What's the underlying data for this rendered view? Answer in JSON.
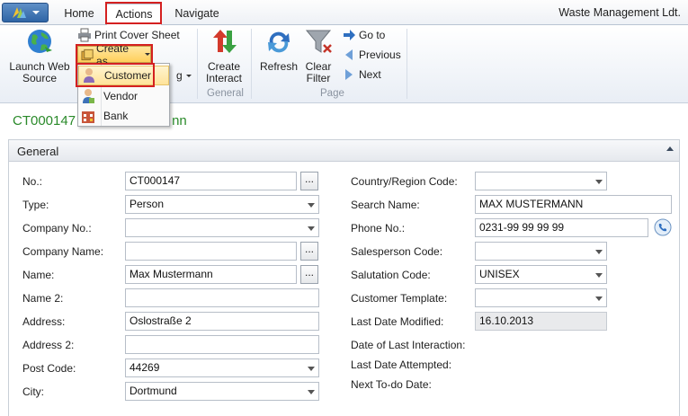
{
  "tabs": {
    "home": "Home",
    "actions": "Actions",
    "navigate": "Navigate"
  },
  "company": "Waste Management Ldt.",
  "ribbon": {
    "launch_web_source": "Launch Web Source",
    "print_cover_sheet": "Print Cover Sheet",
    "create_as": "Create as",
    "create_interact": "Create Interact",
    "refresh": "Refresh",
    "clear_filter": "Clear Filter",
    "go_to": "Go to",
    "previous": "Previous",
    "next": "Next",
    "group_general": "General",
    "group_page": "Page",
    "partial_label": "g"
  },
  "menu": {
    "customer": "Customer",
    "vendor": "Vendor",
    "bank": "Bank"
  },
  "page_title": "CT000147",
  "page_title_tail": "nn",
  "section": {
    "title": "General"
  },
  "left_fields": {
    "no": {
      "label": "No.:",
      "value": "CT000147"
    },
    "type": {
      "label": "Type:",
      "value": "Person"
    },
    "company_no": {
      "label": "Company No.:",
      "value": ""
    },
    "company_name": {
      "label": "Company Name:",
      "value": ""
    },
    "name": {
      "label": "Name:",
      "value": "Max Mustermann"
    },
    "name2": {
      "label": "Name 2:",
      "value": ""
    },
    "address": {
      "label": "Address:",
      "value": "Oslostraße 2"
    },
    "address2": {
      "label": "Address 2:",
      "value": ""
    },
    "post_code": {
      "label": "Post Code:",
      "value": "44269"
    },
    "city": {
      "label": "City:",
      "value": "Dortmund"
    }
  },
  "right_fields": {
    "country": {
      "label": "Country/Region Code:",
      "value": ""
    },
    "search_name": {
      "label": "Search Name:",
      "value": "MAX MUSTERMANN"
    },
    "phone": {
      "label": "Phone No.:",
      "value": "0231-99 99 99 99"
    },
    "salesperson": {
      "label": "Salesperson Code:",
      "value": ""
    },
    "salutation": {
      "label": "Salutation Code:",
      "value": "UNISEX"
    },
    "customer_template": {
      "label": "Customer Template:",
      "value": ""
    },
    "last_modified": {
      "label": "Last Date Modified:",
      "value": "16.10.2013"
    },
    "last_interaction": {
      "label": "Date of Last Interaction:"
    },
    "last_attempted": {
      "label": "Last Date Attempted:"
    },
    "next_todo": {
      "label": "Next To-do Date:"
    }
  },
  "assist_glyph": "...",
  "colors": {
    "title_green": "#2a8a2a",
    "highlight_red": "#d42020"
  }
}
